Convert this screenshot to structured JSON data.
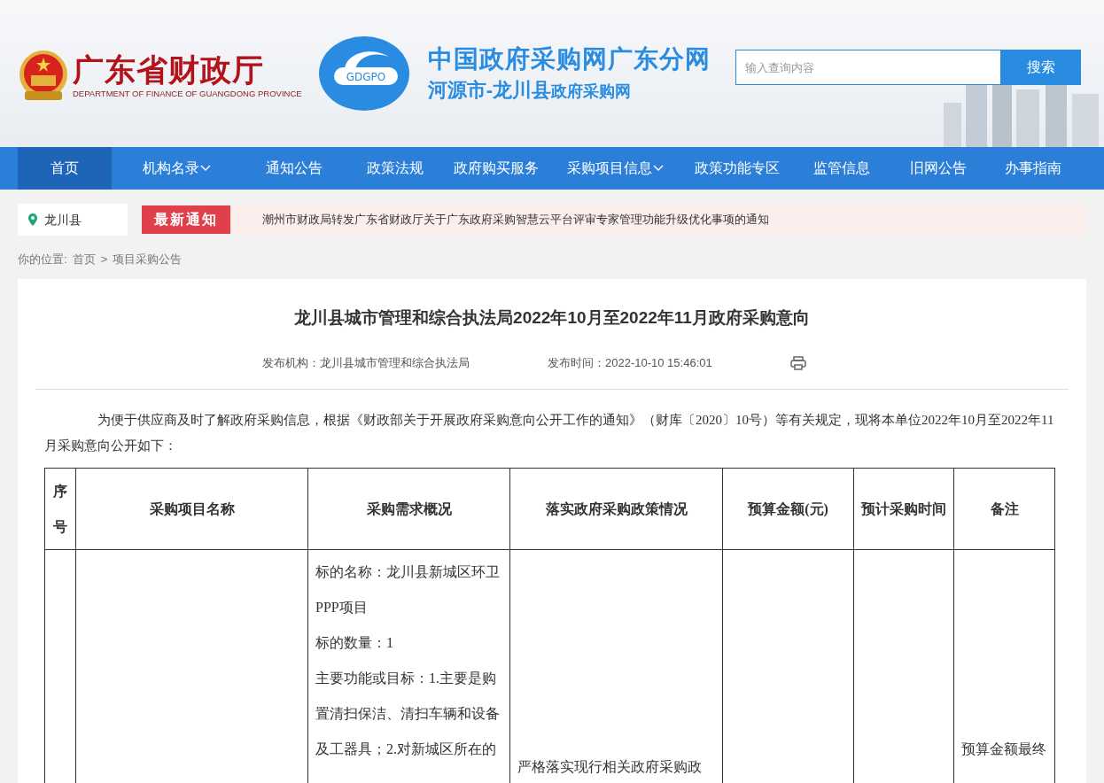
{
  "header": {
    "dept_name": "广东省财政厅",
    "dept_name_en": "DEPARTMENT OF FINANCE OF GUANGDONG PROVINCE",
    "logo_text": "GDGPO",
    "site_title": "中国政府采购网广东分网",
    "site_subtitle_region": "河源市-龙川县",
    "site_subtitle_rest": "政府采购网",
    "search": {
      "placeholder": "输入查询内容",
      "button": "搜索"
    }
  },
  "nav": [
    {
      "label": "首页",
      "selected": true,
      "dropdown": false
    },
    {
      "label": "机构名录",
      "selected": false,
      "dropdown": true
    },
    {
      "label": "通知公告",
      "selected": false,
      "dropdown": false
    },
    {
      "label": "政策法规",
      "selected": false,
      "dropdown": false
    },
    {
      "label": "政府购买服务",
      "selected": false,
      "dropdown": false
    },
    {
      "label": "采购项目信息",
      "selected": false,
      "dropdown": true
    },
    {
      "label": "政策功能专区",
      "selected": false,
      "dropdown": false
    },
    {
      "label": "监管信息",
      "selected": false,
      "dropdown": false
    },
    {
      "label": "旧网公告",
      "selected": false,
      "dropdown": false
    },
    {
      "label": "办事指南",
      "selected": false,
      "dropdown": false
    }
  ],
  "notice": {
    "location": "龙川县",
    "badge": "最新通知",
    "text": "潮州市财政局转发广东省财政厅关于广东政府采购智慧云平台评审专家管理功能升级优化事项的通知"
  },
  "breadcrumb": {
    "label": "你的位置:",
    "items": [
      "首页",
      "项目采购公告"
    ],
    "separator": ">"
  },
  "article": {
    "title": "龙川县城市管理和综合执法局2022年10月至2022年11月政府采购意向",
    "publisher": "发布机构：龙川县城市管理和综合执法局",
    "time": "发布时间：2022-10-10 15:46:01",
    "paragraph": "为便于供应商及时了解政府采购信息，根据《财政部关于开展政府采购意向公开工作的通知》（财库〔2020〕10号）等有关规定，现将本单位2022年10月至2022年11月采购意向公开如下：",
    "table": {
      "columns": [
        "序号",
        "采购项目名称",
        "采购需求概况",
        "落实政府采购政策情况",
        "预算金额(元)",
        "预计采购时间",
        "备注"
      ],
      "rows": [
        {
          "column_3": [
            "标的名称：龙川县新城区环卫PPP项目",
            "标的数量：1",
            "主要功能或目标：1.主要是购置清扫保洁、清扫车辆和设备及工器具；2.对新城区所在的"
          ],
          "column_4": "严格落实现行相关政府采购政",
          "column_7": "预算金额最终"
        }
      ]
    }
  }
}
